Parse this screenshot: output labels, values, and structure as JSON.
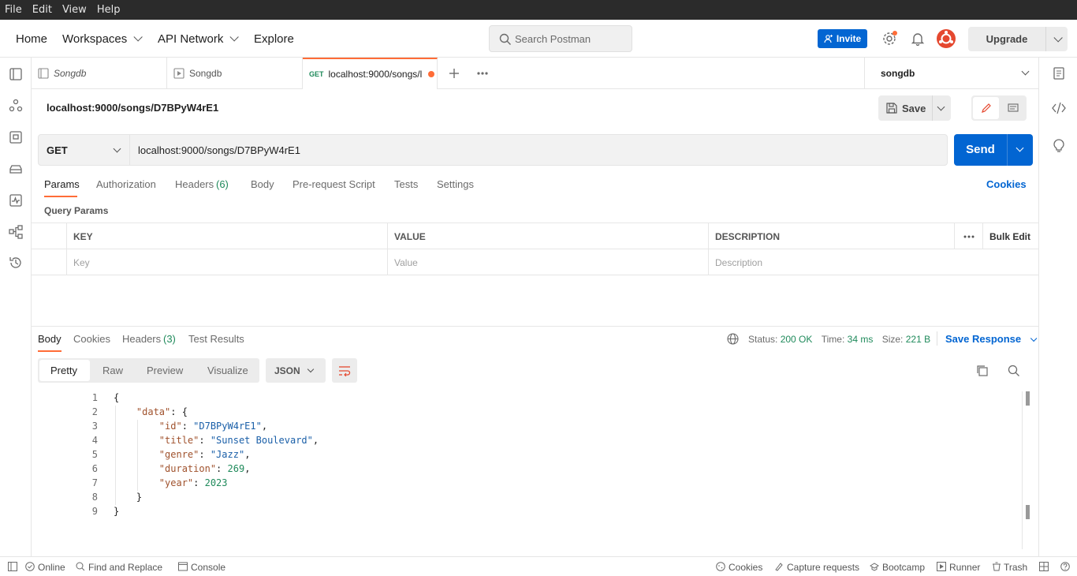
{
  "menubar": {
    "items": [
      "File",
      "Edit",
      "View",
      "Help"
    ]
  },
  "header": {
    "home": "Home",
    "workspaces": "Workspaces",
    "api_network": "API Network",
    "explore": "Explore",
    "search_placeholder": "Search Postman",
    "invite": "Invite",
    "upgrade": "Upgrade"
  },
  "tabs": [
    {
      "label": "Songdb",
      "icon": "collection-icon"
    },
    {
      "label": "Songdb",
      "icon": "runner-icon"
    },
    {
      "method": "GET",
      "label": "localhost:9000/songs/l"
    }
  ],
  "environment": "songdb",
  "request": {
    "title": "localhost:9000/songs/D7BPyW4rE1",
    "save": "Save",
    "method": "GET",
    "url": "localhost:9000/songs/D7BPyW4rE1",
    "send": "Send",
    "tabs": {
      "params": "Params",
      "authorization": "Authorization",
      "headers": "Headers",
      "headers_count": "(6)",
      "body": "Body",
      "prerequest": "Pre-request Script",
      "tests": "Tests",
      "settings": "Settings"
    },
    "cookies": "Cookies",
    "query_params_title": "Query Params",
    "columns": {
      "key": "KEY",
      "value": "VALUE",
      "description": "DESCRIPTION",
      "bulk_edit": "Bulk Edit"
    },
    "placeholders": {
      "key": "Key",
      "value": "Value",
      "description": "Description"
    }
  },
  "response": {
    "tabs": {
      "body": "Body",
      "cookies": "Cookies",
      "headers": "Headers",
      "headers_count": "(3)",
      "test_results": "Test Results"
    },
    "status_label": "Status:",
    "status_value": "200 OK",
    "time_label": "Time:",
    "time_value": "34 ms",
    "size_label": "Size:",
    "size_value": "221 B",
    "save_response": "Save Response",
    "views": {
      "pretty": "Pretty",
      "raw": "Raw",
      "preview": "Preview",
      "visualize": "Visualize"
    },
    "format": "JSON",
    "body_lines": [
      {
        "n": "1",
        "t": "{"
      },
      {
        "n": "2",
        "t": "    \"data\": {"
      },
      {
        "n": "3",
        "t": "        \"id\": \"D7BPyW4rE1\","
      },
      {
        "n": "4",
        "t": "        \"title\": \"Sunset Boulevard\","
      },
      {
        "n": "5",
        "t": "        \"genre\": \"Jazz\","
      },
      {
        "n": "6",
        "t": "        \"duration\": 269,"
      },
      {
        "n": "7",
        "t": "        \"year\": 2023"
      },
      {
        "n": "8",
        "t": "    }"
      },
      {
        "n": "9",
        "t": "}"
      }
    ]
  },
  "statusbar": {
    "online": "Online",
    "find_replace": "Find and Replace",
    "console": "Console",
    "cookies": "Cookies",
    "capture": "Capture requests",
    "bootcamp": "Bootcamp",
    "runner": "Runner",
    "trash": "Trash"
  },
  "colors": {
    "accent": "#ff6c37",
    "primary": "#0265d2",
    "success": "#1f8a5b"
  }
}
